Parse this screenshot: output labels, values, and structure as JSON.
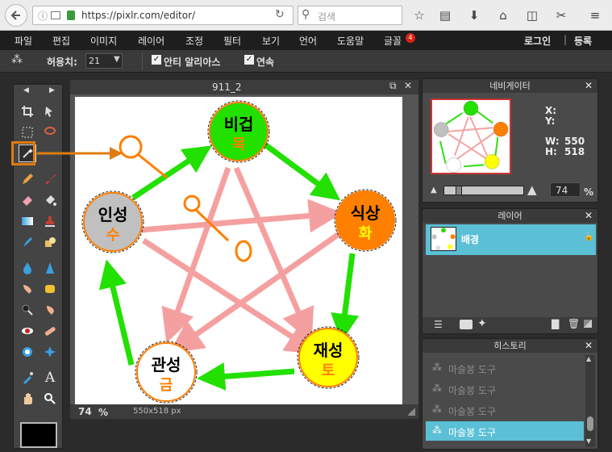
{
  "browser": {
    "url": "https://pixlr.com/editor/",
    "search_placeholder": "검색"
  },
  "menu": {
    "items": [
      "파일",
      "편집",
      "이미지",
      "레이어",
      "조정",
      "필터",
      "보기",
      "언어",
      "도움말",
      "글꼴"
    ],
    "font_badge": "4",
    "login": "로그인",
    "separator": "|",
    "register": "등록"
  },
  "options": {
    "tolerance_label": "허용치:",
    "tolerance_value": "21",
    "antialias_label": "안티 알리아스",
    "contiguous_label": "연속"
  },
  "document": {
    "title": "911_2",
    "zoom": "74",
    "zoom_unit": "%",
    "size": "550x518 px"
  },
  "diagram": {
    "nodes": [
      {
        "label": "비겁",
        "sub": "목",
        "color": "#22e000"
      },
      {
        "label": "식상",
        "sub": "화",
        "color": "#ff7f00"
      },
      {
        "label": "재성",
        "sub": "토",
        "color": "#ffff00"
      },
      {
        "label": "관성",
        "sub": "금",
        "color": "#ffffff"
      },
      {
        "label": "인성",
        "sub": "수",
        "color": "#c0c0c0"
      }
    ],
    "sub_color": "#ff7f00"
  },
  "navigator": {
    "title": "네비게이터",
    "x_label": "X:",
    "y_label": "Y:",
    "w_label": "W:",
    "h_label": "H:",
    "w_value": "550",
    "h_value": "518",
    "zoom": "74",
    "zoom_unit": "%"
  },
  "layers": {
    "title": "레이어",
    "items": [
      {
        "name": "배경"
      }
    ]
  },
  "history": {
    "title": "히스토리",
    "items": [
      "마술봉 도구",
      "마술봉 도구",
      "마술봉 도구",
      "마술봉 도구"
    ]
  },
  "colors": {
    "accent": "#e07b10",
    "panel_highlight": "#5bc0d6"
  }
}
